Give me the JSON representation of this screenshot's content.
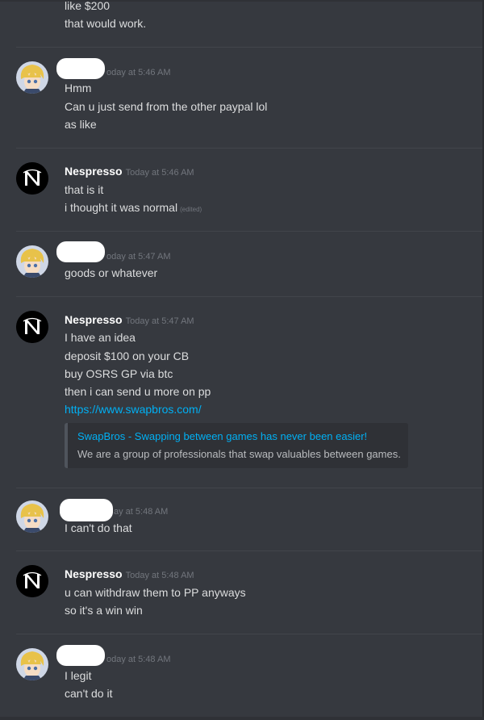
{
  "messages": [
    {
      "author_redacted": true,
      "timestamp": "",
      "lines": [
        "like $200",
        "that would work."
      ]
    },
    {
      "author_redacted": true,
      "timestamp": "oday at 5:46 AM",
      "lines": [
        "Hmm",
        "Can u just send from the other paypal lol",
        "as like"
      ]
    },
    {
      "author": "Nespresso",
      "timestamp": "Today at 5:46 AM",
      "lines": [
        "that is it",
        "i thought it was normal"
      ],
      "edited_label": "(edited)"
    },
    {
      "author_redacted": true,
      "timestamp": "oday at 5:47 AM",
      "lines": [
        "goods or whatever"
      ]
    },
    {
      "author": "Nespresso",
      "timestamp": "Today at 5:47 AM",
      "lines": [
        "I have an idea",
        "deposit $100 on your CB",
        "buy OSRS GP via btc",
        "then i can send u more on pp"
      ],
      "link": "https://www.swapbros.com/",
      "embed": {
        "title": "SwapBros - Swapping between games has never been easier!",
        "description": "We are a group of professionals that swap valuables between games."
      }
    },
    {
      "author_redacted": true,
      "timestamp": "ay at 5:48 AM",
      "lines": [
        "I can't do that"
      ]
    },
    {
      "author": "Nespresso",
      "timestamp": "Today at 5:48 AM",
      "lines": [
        "u can withdraw them to PP anyways",
        "so it's a win win"
      ]
    },
    {
      "author_redacted": true,
      "timestamp": "oday at 5:48 AM",
      "lines": [
        "I legit",
        "can't do it"
      ]
    }
  ],
  "avatars": {
    "anime": "anime-character-avatar",
    "nespresso": "nespresso-logo-avatar"
  },
  "colors": {
    "background": "#36393f",
    "username": "#ffffff",
    "timestamp": "#72767d",
    "text": "#dcddde",
    "link": "#00b0f4",
    "embed_bg": "#2f3136"
  }
}
